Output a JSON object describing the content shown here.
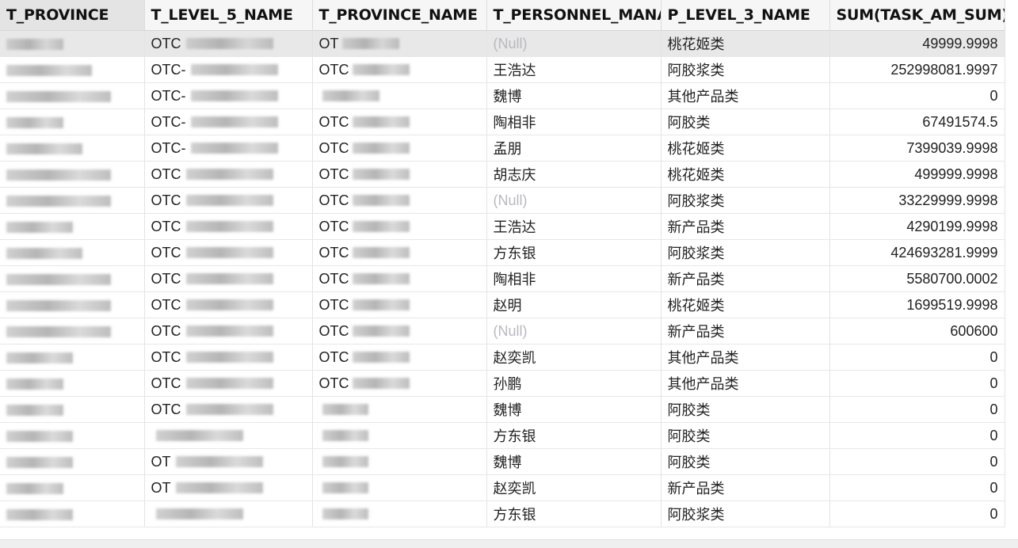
{
  "columns": [
    "T_PROVINCE",
    "T_LEVEL_5_NAME",
    "T_PROVINCE_NAME",
    "T_PERSONNEL_MANA",
    "P_LEVEL_3_NAME",
    "SUM(TASK_AM_SUM)"
  ],
  "rows": [
    {
      "col2_prefix": "OTC",
      "col3_prefix": "OT",
      "manager": "(Null)",
      "category": "桃花姬类",
      "sum": "49999.9998"
    },
    {
      "col2_prefix": "OTC-",
      "col3_prefix": "OTC",
      "manager": "王浩达",
      "category": "阿胶浆类",
      "sum": "252998081.9997"
    },
    {
      "col2_prefix": "OTC-",
      "col3_prefix": "",
      "manager": "魏博",
      "category": "其他产品类",
      "sum": "0"
    },
    {
      "col2_prefix": "OTC-",
      "col3_prefix": "OTC",
      "manager": "陶相非",
      "category": "阿胶类",
      "sum": "67491574.5"
    },
    {
      "col2_prefix": "OTC-",
      "col3_prefix": "OTC",
      "manager": "孟朋",
      "category": "桃花姬类",
      "sum": "7399039.9998"
    },
    {
      "col2_prefix": "OTC",
      "col3_prefix": "OTC",
      "manager": "胡志庆",
      "category": "桃花姬类",
      "sum": "499999.9998"
    },
    {
      "col2_prefix": "OTC",
      "col3_prefix": "OTC",
      "manager": "(Null)",
      "category": "阿胶浆类",
      "sum": "33229999.9998"
    },
    {
      "col2_prefix": "OTC",
      "col3_prefix": "OTC",
      "manager": "王浩达",
      "category": "新产品类",
      "sum": "4290199.9998"
    },
    {
      "col2_prefix": "OTC",
      "col3_prefix": "OTC",
      "manager": "方东银",
      "category": "阿胶浆类",
      "sum": "424693281.9999"
    },
    {
      "col2_prefix": "OTC",
      "col3_prefix": "OTC",
      "manager": "陶相非",
      "category": "新产品类",
      "sum": "5580700.0002"
    },
    {
      "col2_prefix": "OTC",
      "col3_prefix": "OTC",
      "manager": "赵明",
      "category": "桃花姬类",
      "sum": "1699519.9998"
    },
    {
      "col2_prefix": "OTC",
      "col3_prefix": "OTC",
      "manager": "(Null)",
      "category": "新产品类",
      "sum": "600600"
    },
    {
      "col2_prefix": "OTC",
      "col3_prefix": "OTC",
      "manager": "赵奕凯",
      "category": "其他产品类",
      "sum": "0"
    },
    {
      "col2_prefix": "OTC",
      "col3_prefix": "OTC",
      "manager": "孙鹏",
      "category": "其他产品类",
      "sum": "0"
    },
    {
      "col2_prefix": "OTC",
      "col3_prefix": "",
      "manager": "魏博",
      "category": "阿胶类",
      "sum": "0"
    },
    {
      "col2_prefix": "",
      "col3_prefix": "",
      "manager": "方东银",
      "category": "阿胶类",
      "sum": "0"
    },
    {
      "col2_prefix": "OT",
      "col3_prefix": "",
      "manager": "魏博",
      "category": "阿胶类",
      "sum": "0"
    },
    {
      "col2_prefix": "OT",
      "col3_prefix": "",
      "manager": "赵奕凯",
      "category": "新产品类",
      "sum": "0"
    },
    {
      "col2_prefix": "",
      "col3_prefix": "",
      "manager": "方东银",
      "category": "阿胶浆类",
      "sum": "0"
    }
  ]
}
